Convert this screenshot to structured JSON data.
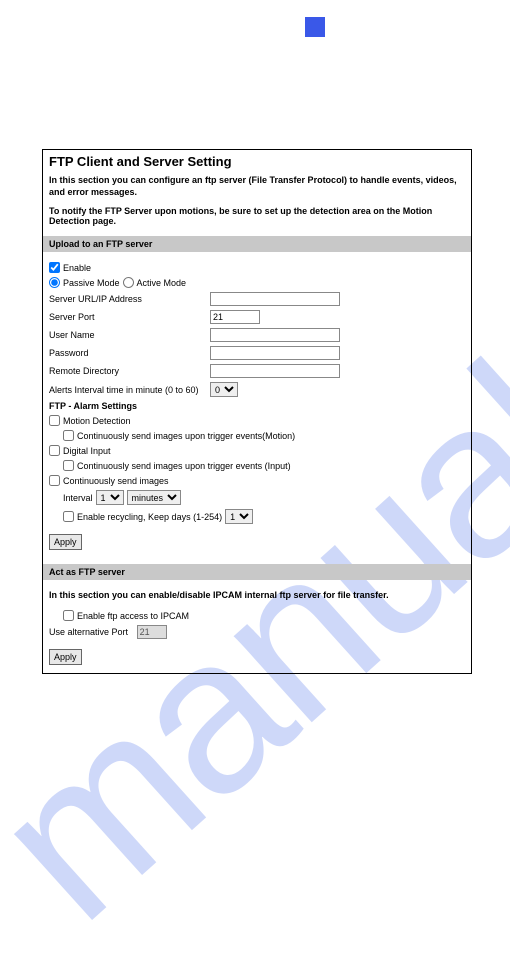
{
  "watermark": "manualshive.com",
  "title": "FTP Client and Server Setting",
  "intro": "In this section you can configure an ftp server (File Transfer Protocol) to handle events, videos, and error messages.",
  "notify": "To notify the FTP Server upon motions, be sure to set up the detection area on the Motion Detection page.",
  "sec1": "Upload to an FTP server",
  "enable": "Enable",
  "passive": "Passive Mode",
  "active": "Active Mode",
  "server_url_lbl": "Server URL/IP Address",
  "server_port_lbl": "Server Port",
  "server_port_val": "21",
  "username_lbl": "User Name",
  "password_lbl": "Password",
  "remote_dir_lbl": "Remote Directory",
  "alerts_lbl": "Alerts Interval time in minute (0 to 60)",
  "alerts_val": "0",
  "alarm_head": "FTP - Alarm Settings",
  "motion": "Motion Detection",
  "motion_sub": "Continuously send images upon trigger events(Motion)",
  "digital": "Digital Input",
  "digital_sub": "Continuously send images upon trigger events (Input)",
  "cont_send": "Continuously send images",
  "interval_lbl": "Interval",
  "interval_num": "1",
  "interval_unit": "minutes",
  "recycle_lbl": "Enable recycling, Keep days (1-254)",
  "recycle_val": "1",
  "apply": "Apply",
  "sec2": "Act as FTP server",
  "sec2_intro": "In this section you can enable/disable IPCAM internal ftp server for file transfer.",
  "enable_ftp_ipcam": "Enable ftp access to IPCAM",
  "alt_port_lbl": "Use alternative Port",
  "alt_port_val": "21"
}
